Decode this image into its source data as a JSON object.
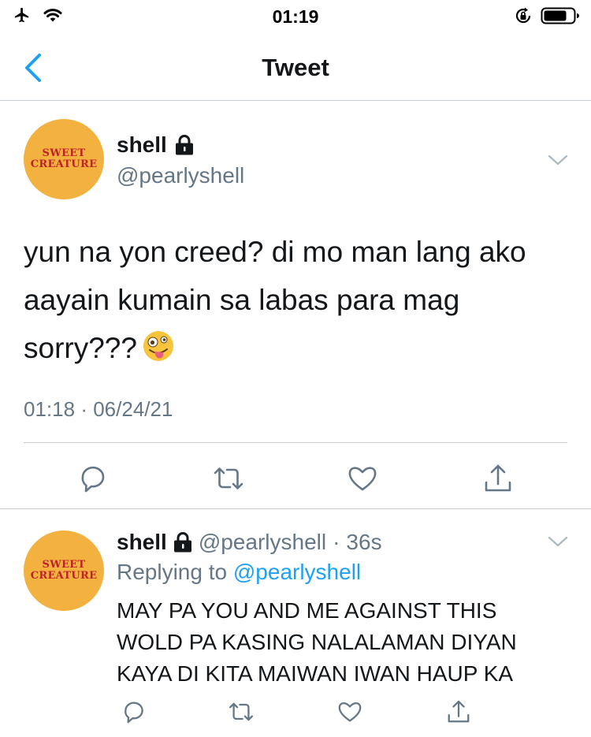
{
  "status_bar": {
    "time": "01:19",
    "icons": [
      "airplane-icon",
      "wifi-icon",
      "rotation-lock-icon",
      "battery-icon"
    ]
  },
  "nav": {
    "title": "Tweet",
    "back_icon": "chevron-left-icon"
  },
  "main_tweet": {
    "avatar_text": [
      "SWEET",
      "CREATURE"
    ],
    "display_name": "shell",
    "handle": "@pearlyshell",
    "protected_icon": "lock-icon",
    "text": "yun na yon creed? di mo man lang ako aayain kumain sa labas para mag sorry???",
    "emoji": "zany-face-emoji",
    "time": "01:18",
    "separator": "·",
    "date": "06/24/21",
    "actions": [
      "reply-icon",
      "retweet-icon",
      "like-icon",
      "share-icon"
    ]
  },
  "reply_tweet": {
    "avatar_text": [
      "SWEET",
      "CREATURE"
    ],
    "display_name": "shell",
    "handle": "@pearlyshell",
    "separator": "·",
    "time_ago": "36s",
    "replying_prefix": "Replying to",
    "replying_to": "@pearlyshell",
    "text_lines": [
      "MAY PA YOU AND ME AGAINST THIS",
      "WOLD PA KASING NALALAMAN DIYAN",
      "KAYA DI KITA MAIWAN IWAN HAUP KA"
    ],
    "actions": [
      "reply-icon",
      "retweet-icon",
      "like-icon",
      "share-icon"
    ]
  },
  "colors": {
    "accent": "#1da1f2",
    "secondary_text": "#657786",
    "avatar_bg": "#f3b23f",
    "avatar_text": "#c0202b",
    "divider": "#c8cdd1"
  }
}
